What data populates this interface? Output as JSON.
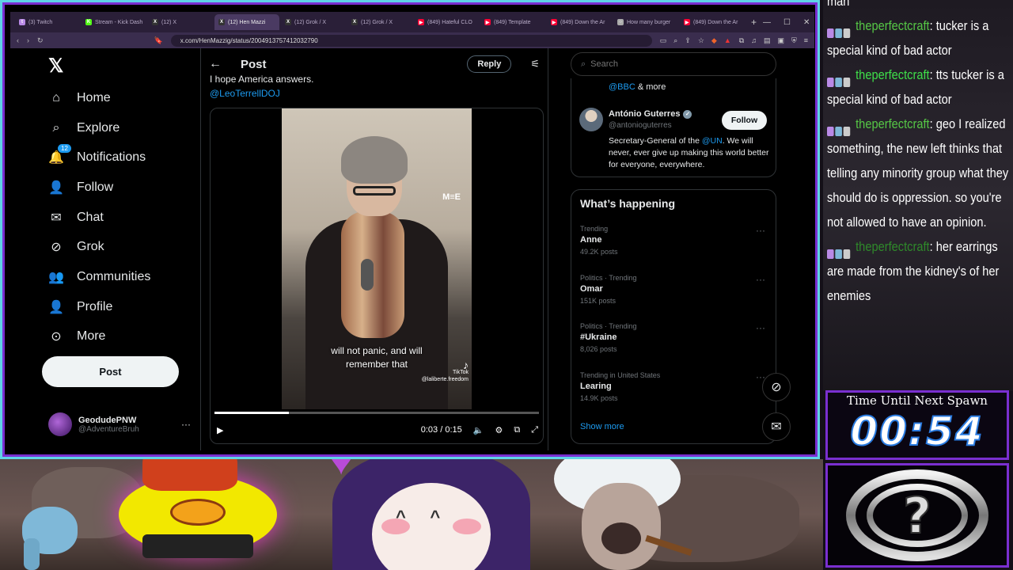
{
  "browser": {
    "tabs": [
      {
        "label": "(3) Twitch",
        "color": "#b98ae6",
        "glyph": "t"
      },
      {
        "label": "Stream - Kick Dash",
        "color": "#53fc18",
        "glyph": "K"
      },
      {
        "label": "(12) X",
        "color": "#333",
        "glyph": "X"
      },
      {
        "label": "(12) Hen Mazzi",
        "color": "#333",
        "glyph": "X",
        "active": true
      },
      {
        "label": "(12) Grok / X",
        "color": "#333",
        "glyph": "X"
      },
      {
        "label": "(12) Grok / X",
        "color": "#333",
        "glyph": "X"
      },
      {
        "label": "(849) Hateful CLO",
        "color": "#ff0033",
        "glyph": "▶"
      },
      {
        "label": "(849) Template",
        "color": "#ff0033",
        "glyph": "▶"
      },
      {
        "label": "(849) Down the Ar",
        "color": "#ff0033",
        "glyph": "▶"
      },
      {
        "label": "How many burger",
        "color": "#aaa",
        "glyph": "○"
      },
      {
        "label": "(849) Down the Ar",
        "color": "#ff0033",
        "glyph": "▶"
      }
    ],
    "url": "x.com/HenMazzig/status/2004913757412032790"
  },
  "nav": {
    "items": [
      {
        "label": "Home",
        "icon": "home-icon",
        "glyph": "⌂"
      },
      {
        "label": "Explore",
        "icon": "search-icon",
        "glyph": "⌕"
      },
      {
        "label": "Notifications",
        "icon": "bell-icon",
        "glyph": "🔔",
        "badge": "12"
      },
      {
        "label": "Follow",
        "icon": "add-person-icon",
        "glyph": "👤"
      },
      {
        "label": "Chat",
        "icon": "mail-icon",
        "glyph": "✉"
      },
      {
        "label": "Grok",
        "icon": "grok-icon",
        "glyph": "⊘"
      },
      {
        "label": "Communities",
        "icon": "communities-icon",
        "glyph": "👥"
      },
      {
        "label": "Profile",
        "icon": "person-icon",
        "glyph": "👤"
      },
      {
        "label": "More",
        "icon": "more-circle-icon",
        "glyph": "⊙"
      }
    ],
    "post_label": "Post"
  },
  "account": {
    "name": "GeodudePNW",
    "handle": "@AdventureBruh"
  },
  "post": {
    "title": "Post",
    "reply_label": "Reply",
    "text": "I hope America answers.",
    "mention": "@LeoTerrellDOJ",
    "video": {
      "watermark": "M≡E",
      "subtitle_line1": "will not panic, and will",
      "subtitle_line2": "remember that",
      "tiktok_label": "TikTok",
      "tiktok_handle": "@laliberte.freedom",
      "time": "0:03 / 0:15",
      "progress_fraction": 0.23
    }
  },
  "sidebar": {
    "search_placeholder": "Search",
    "bbc_prefix": "@BBC",
    "bbc_suffix": " & more",
    "suggest": {
      "name": "António Guterres",
      "handle": "@antonioguterres",
      "bio_pre": "Secretary-General of the ",
      "bio_link": "@UN",
      "bio_post": ". We will never, ever give up making this world better for everyone, everywhere.",
      "follow_label": "Follow"
    },
    "happening_title": "What’s happening",
    "trends": [
      {
        "meta": "Trending",
        "name": "Anne",
        "count": "49.2K posts"
      },
      {
        "meta": "Politics · Trending",
        "name": "Omar",
        "count": "151K posts"
      },
      {
        "meta": "Politics · Trending",
        "name": "#Ukraine",
        "count": "8,026 posts"
      },
      {
        "meta": "Trending in United States",
        "name": "Learing",
        "count": "14.9K posts"
      }
    ],
    "show_more": "Show more"
  },
  "chat": {
    "messages": [
      {
        "user": "",
        "text": "man",
        "first": true
      },
      {
        "user": "theperfectcraft",
        "text": ": tucker is a special kind of bad actor",
        "style": "normal"
      },
      {
        "user": "theperfectcraft",
        "text": ": tts tucker is a special kind of bad actor",
        "style": "bright"
      },
      {
        "user": "theperfectcraft",
        "text": ": geo I realized something, the new left thinks that telling any minority group what they should do is oppression. so you're not allowed to have an opinion.",
        "style": "normal"
      },
      {
        "user": "theperfectcraft",
        "text": ": her earrings are made from the kidney's of her enemies",
        "style": "faded"
      }
    ]
  },
  "timer": {
    "label": "Time Until Next Spawn",
    "value": "00:54"
  },
  "colors": {
    "accent": "#1d9bf0",
    "frame": "#5fd3e6",
    "purple": "#7a2fd0",
    "chat_user": "#56c846"
  }
}
